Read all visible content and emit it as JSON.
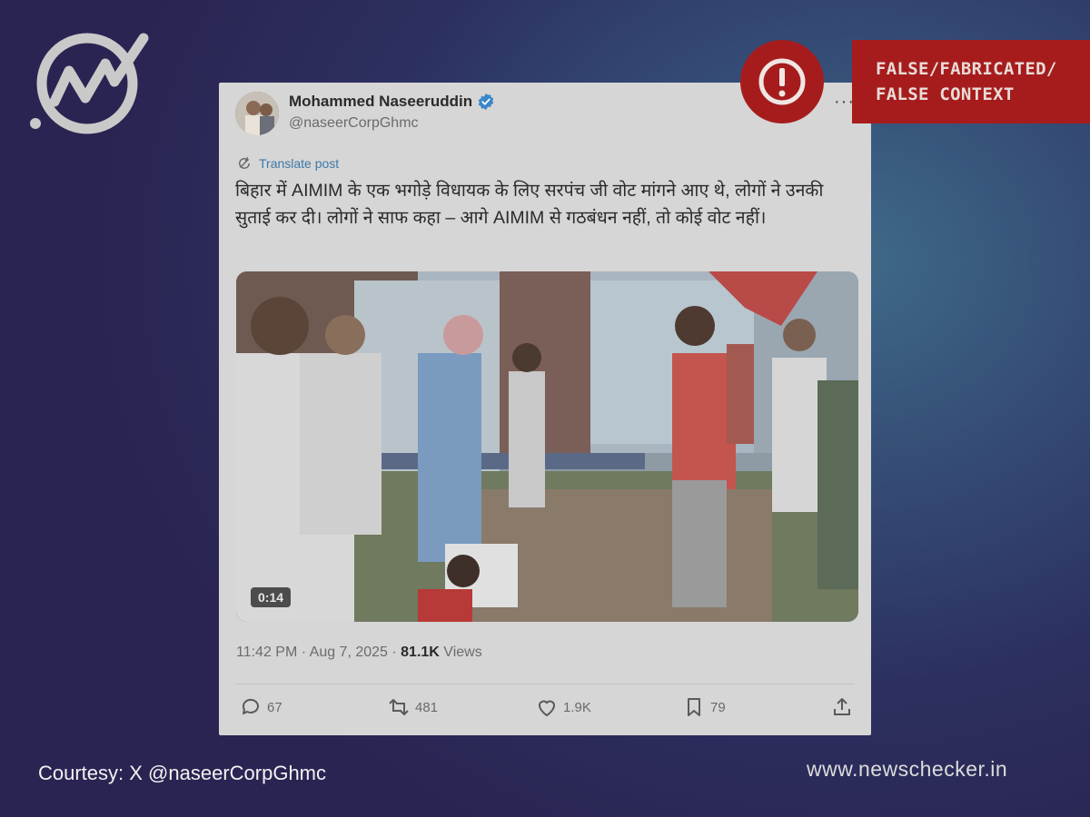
{
  "tweet": {
    "author_name": "Mohammed Naseeruddin",
    "handle": "@naseerCorpGhmc",
    "more": "···",
    "translate_label": "Translate post",
    "text": "बिहार में AIMIM के एक भगोड़े विधायक के लिए सरपंच जी वोट मांगने आए थे, लोगों ने उनकी सुताई कर दी। लोगों ने साफ कहा – आगे AIMIM से गठबंधन नहीं, तो कोई वोट नहीं।",
    "video_duration": "0:14",
    "time": "11:42 PM",
    "date": "Aug 7, 2025",
    "separator": " · ",
    "views_count": "81.1K",
    "views_label": " Views",
    "actions": {
      "replies": "67",
      "reposts": "481",
      "likes": "1.9K",
      "bookmarks": "79"
    }
  },
  "fact_check": {
    "verdict": "FALSE/FABRICATED/ FALSE CONTEXT",
    "color": "#a61c1c"
  },
  "footer": {
    "courtesy": "Courtesy: X @naseerCorpGhmc",
    "site": "www.newschecker.in"
  },
  "icons": {
    "logo": "newschecker-logo-icon",
    "verified": "verified-badge-icon",
    "alert": "exclamation-icon"
  }
}
